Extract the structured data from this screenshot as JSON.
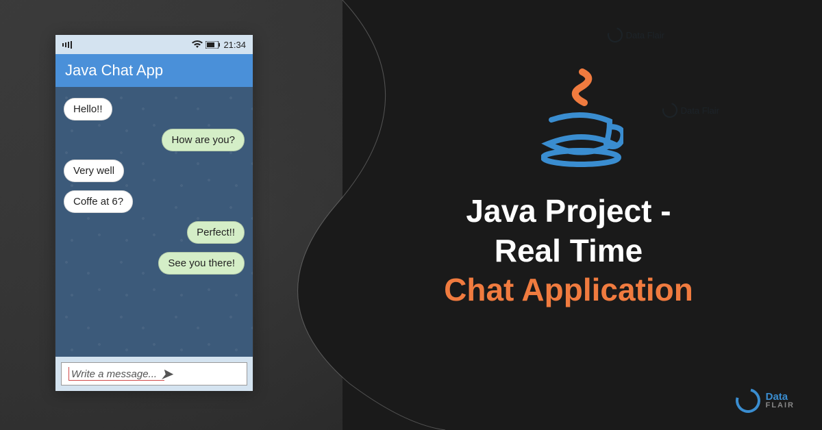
{
  "statusbar": {
    "time": "21:34"
  },
  "app": {
    "title": "Java Chat App"
  },
  "messages": [
    {
      "text": "Hello!!",
      "side": "left"
    },
    {
      "text": "How are you?",
      "side": "right"
    },
    {
      "text": "Very well",
      "side": "left"
    },
    {
      "text": "Coffe at 6?",
      "side": "left"
    },
    {
      "text": "Perfect!!",
      "side": "right"
    },
    {
      "text": "See you there!",
      "side": "right"
    }
  ],
  "input": {
    "placeholder": "Write a message..."
  },
  "title": {
    "line1": "Java Project -",
    "line2": "Real Time",
    "line3": "Chat Application"
  },
  "brand": {
    "name1": "Data",
    "name2": "FLAIR"
  }
}
